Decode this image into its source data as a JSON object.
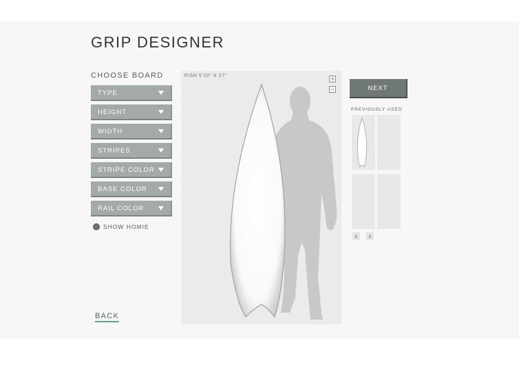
{
  "app": {
    "title": "GRIP DESIGNER"
  },
  "board_panel": {
    "heading": "CHOOSE BOARD",
    "dropdowns": [
      {
        "label": "TYPE"
      },
      {
        "label": "HEIGHT"
      },
      {
        "label": "WIDTH"
      },
      {
        "label": "STRIPES"
      },
      {
        "label": "STRIPE COLOR"
      },
      {
        "label": "BASE COLOR"
      },
      {
        "label": "RAIL COLOR"
      }
    ],
    "show_homie": {
      "label": "SHOW HOMIE",
      "checked": true
    }
  },
  "preview": {
    "caption": "FISH 5'10\" X 27\"",
    "zoom_in": "+",
    "zoom_out": "−"
  },
  "actions": {
    "next": "NEXT",
    "back": "BACK"
  },
  "previously_used": {
    "label": "PREVIOUSLY USED"
  },
  "colors": {
    "dropdown_bg": "#a4aaaa",
    "next_bg": "#6f7877",
    "canvas_bg": "#ebebeb",
    "homie_silhouette": "#c7c9c9",
    "back_underline": "#6b9a91"
  },
  "icons": {
    "dropdown_arrow": "chevron-down-icon",
    "zoom_in": "plus-icon",
    "zoom_out": "minus-icon",
    "pager_prev": "triangle-left-icon",
    "pager_next": "triangle-right-icon"
  }
}
